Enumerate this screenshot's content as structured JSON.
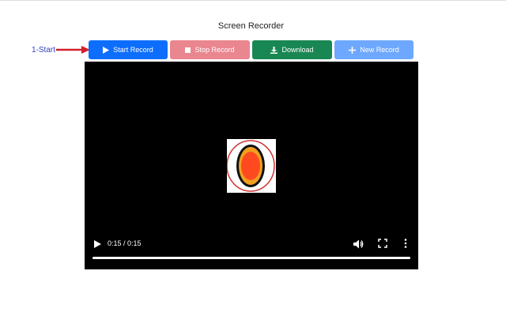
{
  "page": {
    "title": "Screen Recorder"
  },
  "annotation": {
    "label": "1-Start",
    "color": "#d0202a"
  },
  "toolbar": {
    "start_label": "Start Record",
    "stop_label": "Stop Record",
    "download_label": "Download",
    "new_label": "New Record"
  },
  "colors": {
    "start": "#0d6efd",
    "stop": "#ea868f",
    "download": "#198754",
    "new": "#6ea8fe",
    "video_bg": "#000000"
  },
  "video": {
    "time": "0:15 / 0:15",
    "progress": 1.0
  }
}
